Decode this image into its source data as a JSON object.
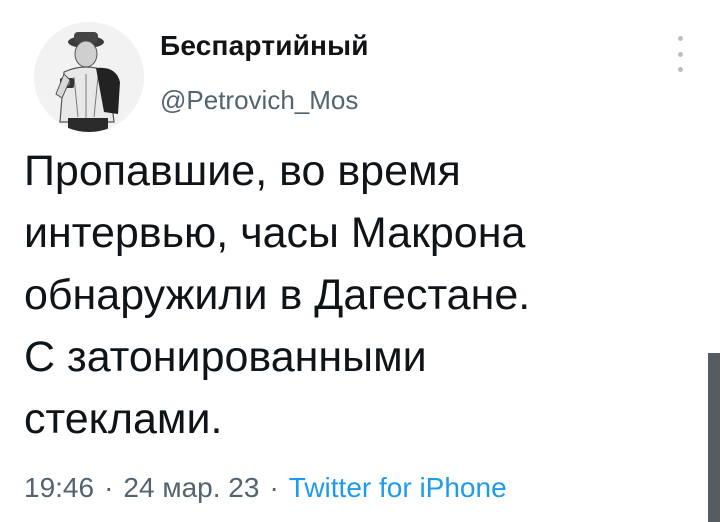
{
  "author": {
    "display_name": "Беспартийный",
    "handle": "@Petrovich_Mos",
    "avatar_icon": "profile-photo-man-with-camera-icon"
  },
  "menu": {
    "icon": "more-vertical-icon"
  },
  "tweet": {
    "lines": [
      "Пропавшие, во время",
      "интервью, часы Макрона",
      "обнаружили в Дагестане.",
      "С затонированными",
      "стеклами."
    ]
  },
  "meta": {
    "time": "19:46",
    "separator": "·",
    "date": "24 мар. 23",
    "source": "Twitter for iPhone"
  },
  "colors": {
    "text": "#0f1419",
    "secondary": "#536471",
    "link": "#1d9bf0",
    "background": "#ffffff"
  }
}
